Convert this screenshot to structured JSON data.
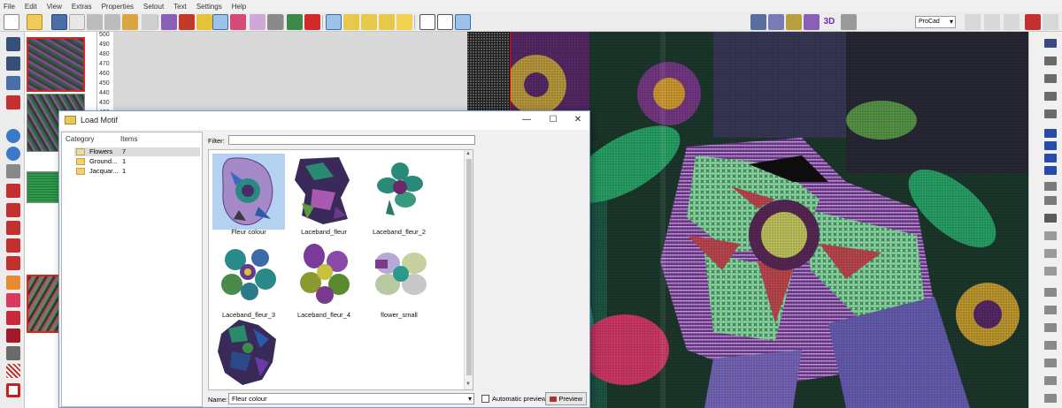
{
  "menu": [
    "File",
    "Edit",
    "View",
    "Extras",
    "Properties",
    "Setout",
    "Text",
    "Settings",
    "Help"
  ],
  "toolbar": {
    "mode_select": "ProCad",
    "threed_label": "3D"
  },
  "row_ruler": [
    "500",
    "490",
    "480",
    "470",
    "460",
    "450",
    "440",
    "430",
    "420"
  ],
  "dialog": {
    "title": "Load Motif",
    "category_header": "Category",
    "items_header": "Items",
    "categories": [
      {
        "name": "Flowers",
        "count": "7"
      },
      {
        "name": "Ground...",
        "count": "1"
      },
      {
        "name": "Jacquar...",
        "count": "1"
      }
    ],
    "filter_label": "Filter:",
    "filter_value": "",
    "motifs": [
      {
        "label": "Fleur colour"
      },
      {
        "label": "Laceband_fleur"
      },
      {
        "label": "Laceband_fleur_2"
      },
      {
        "label": "Laceband_fleur_3"
      },
      {
        "label": "Laceband_fleur_4"
      },
      {
        "label": "flower_small"
      },
      {
        "label": ""
      }
    ],
    "name_label": "Name:",
    "name_value": "Fleur colour",
    "auto_preview_label": "Automatic preview",
    "preview_label": "Preview"
  },
  "colors": {
    "accent": "#1f5fa8",
    "selection": "#b4d2ef",
    "dialog_border": "#7a9cc6"
  }
}
